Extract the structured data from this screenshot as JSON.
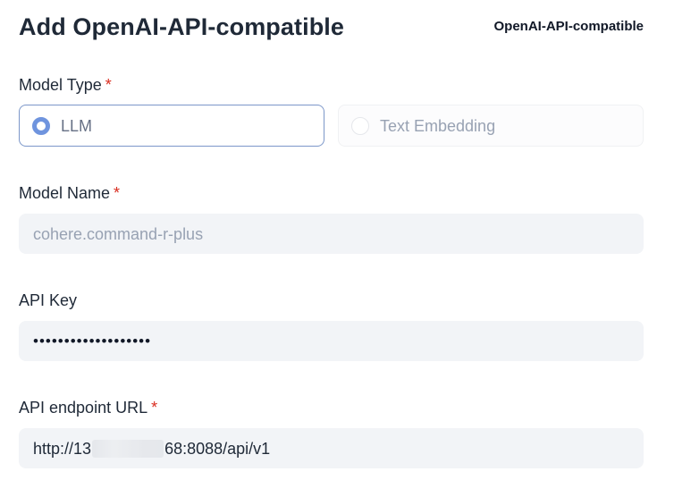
{
  "header": {
    "title": "Add OpenAI-API-compatible",
    "provider": "OpenAI-API-compatible"
  },
  "model_type": {
    "label": "Model Type",
    "required_mark": "*",
    "options": [
      {
        "label": "LLM",
        "selected": true
      },
      {
        "label": "Text Embedding",
        "selected": false
      }
    ]
  },
  "model_name": {
    "label": "Model Name",
    "required_mark": "*",
    "placeholder": "cohere.command-r-plus"
  },
  "api_key": {
    "label": "API Key",
    "value": "•••••••••••••••••••"
  },
  "endpoint": {
    "label": "API endpoint URL",
    "required_mark": "*",
    "value_prefix": "http://13",
    "value_suffix": "68:8088/api/v1"
  },
  "colors": {
    "accent": "#6f94de",
    "required": "#d92d20",
    "input_bg": "#f2f4f7"
  }
}
